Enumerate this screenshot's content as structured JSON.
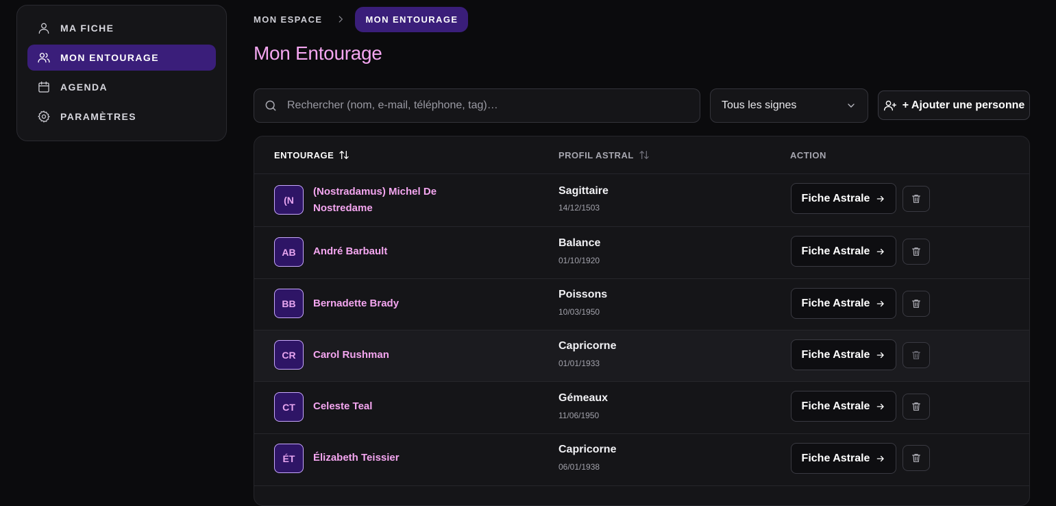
{
  "sidebar": {
    "items": [
      {
        "label": "MA FICHE",
        "icon": "user-icon",
        "active": false
      },
      {
        "label": "MON ENTOURAGE",
        "icon": "users-icon",
        "active": true
      },
      {
        "label": "AGENDA",
        "icon": "calendar-icon",
        "active": false
      },
      {
        "label": "PARAMÈTRES",
        "icon": "gear-icon",
        "active": false
      }
    ]
  },
  "breadcrumb": {
    "parent": "MON ESPACE",
    "current": "MON ENTOURAGE"
  },
  "page": {
    "title": "Mon Entourage"
  },
  "toolbar": {
    "search_placeholder": "Rechercher (nom, e-mail, téléphone, tag)…",
    "sign_filter": "Tous les signes",
    "add_label": "+ Ajouter une personne"
  },
  "table": {
    "headers": {
      "entourage": "ENTOURAGE",
      "profil": "PROFIL ASTRAL",
      "action": "ACTION"
    },
    "rows": [
      {
        "initials": "(N",
        "name": "(Nostradamus) Michel De Nostredame",
        "sign": "Sagittaire",
        "date": "14/12/1503"
      },
      {
        "initials": "AB",
        "name": "André Barbault",
        "sign": "Balance",
        "date": "01/10/1920"
      },
      {
        "initials": "BB",
        "name": "Bernadette Brady",
        "sign": "Poissons",
        "date": "10/03/1950"
      },
      {
        "initials": "CR",
        "name": "Carol Rushman",
        "sign": "Capricorne",
        "date": "01/01/1933"
      },
      {
        "initials": "CT",
        "name": "Celeste Teal",
        "sign": "Gémeaux",
        "date": "11/06/1950"
      },
      {
        "initials": "ÉT",
        "name": "Élizabeth Teissier",
        "sign": "Capricorne",
        "date": "06/01/1938"
      }
    ],
    "action_label": "Fiche Astrale"
  },
  "colors": {
    "accent": "#3a1e7a",
    "pink": "#f4a6f0",
    "background": "#0b0b0d"
  }
}
